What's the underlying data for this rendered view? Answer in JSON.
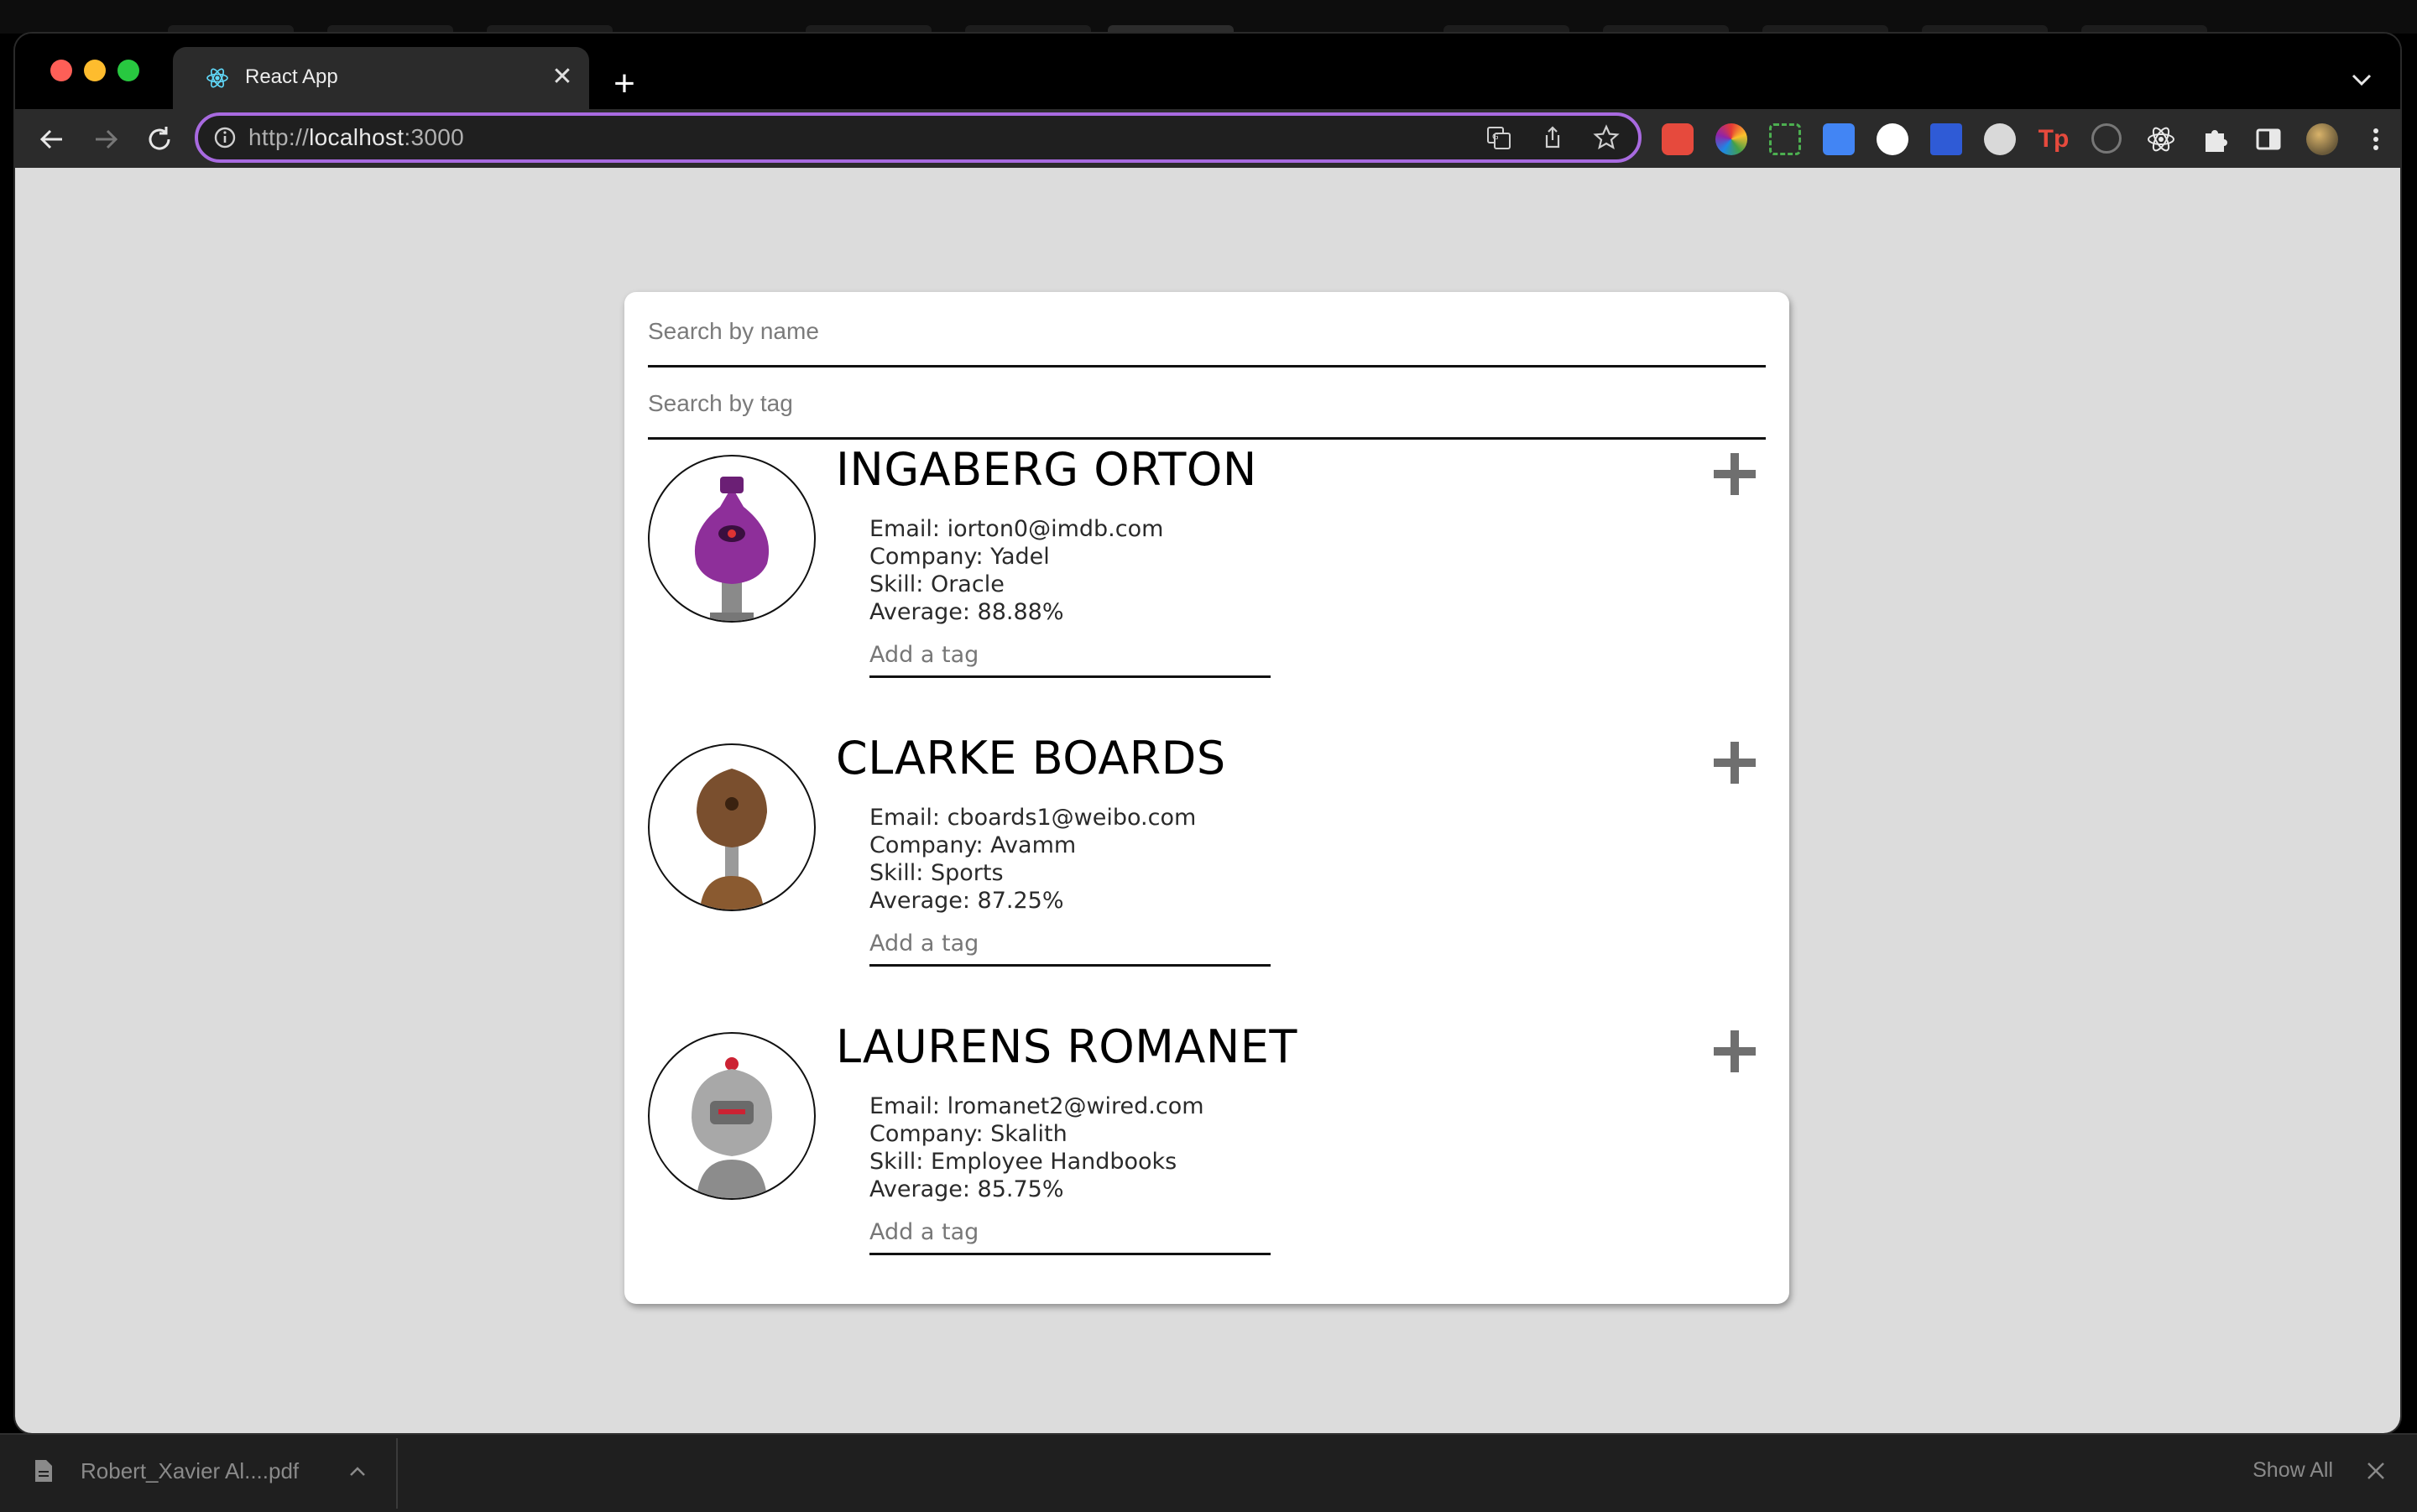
{
  "browser": {
    "tab_title": "React App",
    "url_prefix": "http://",
    "url_host": "localhost",
    "url_port": ":3000",
    "accent_color": "#a86ae0"
  },
  "search": {
    "name_placeholder": "Search by name",
    "tag_placeholder": "Search by tag"
  },
  "students": [
    {
      "name": "INGABERG ORTON",
      "email": "Email: iorton0@imdb.com",
      "company": "Company: Yadel",
      "skill": "Skill: Oracle",
      "average": "Average: 88.88%",
      "tag_placeholder": "Add a tag",
      "avatar_color": "#8e2f9a"
    },
    {
      "name": "CLARKE BOARDS",
      "email": "Email: cboards1@weibo.com",
      "company": "Company: Avamm",
      "skill": "Skill: Sports",
      "average": "Average: 87.25%",
      "tag_placeholder": "Add a tag",
      "avatar_color": "#7a4f2e"
    },
    {
      "name": "LAURENS ROMANET",
      "email": "Email: lromanet2@wired.com",
      "company": "Company: Skalith",
      "skill": "Skill: Employee Handbooks",
      "average": "Average: 85.75%",
      "tag_placeholder": "Add a tag",
      "avatar_color": "#9a9a9a"
    }
  ],
  "downloads": {
    "file_name": "Robert_Xavier Al....pdf",
    "show_all": "Show All"
  }
}
